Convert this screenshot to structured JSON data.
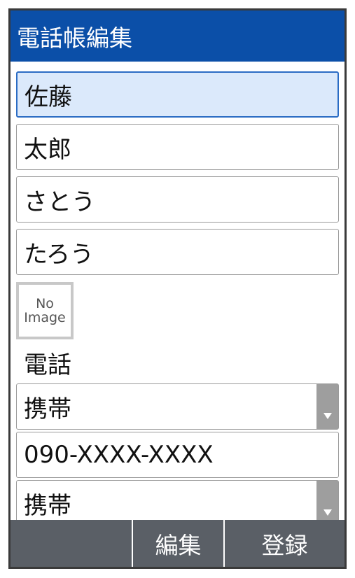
{
  "titlebar": {
    "title": "電話帳編集"
  },
  "form": {
    "last_name": "佐藤",
    "first_name": "太郎",
    "last_name_reading": "さとう",
    "first_name_reading": "たろう"
  },
  "photo": {
    "line1": "No",
    "line2": "Image"
  },
  "phone_section": {
    "label": "電話",
    "type_1": "携帯",
    "number_1": "090-XXXX-XXXX",
    "type_2": "携帯"
  },
  "softkeys": {
    "left": "",
    "center": "編集",
    "right": "登録"
  },
  "colors": {
    "titlebar": "#0b4fa8",
    "focus_fill": "#dbe9fb",
    "softkey_bar": "#5a5f66"
  }
}
